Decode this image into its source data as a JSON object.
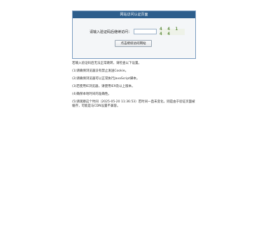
{
  "panel": {
    "title": "网站访问认证页面",
    "prompt_label": "请输入验证码后继续访问：",
    "captcha_text": "4 4 1 4 4",
    "submit_label": "点击继续访问网站"
  },
  "notes": {
    "intro": "若输入验证码后无法正常跳转，请检查以下设置。",
    "items": [
      "(1)请确保浏览器没有禁止发送Cookie。",
      "(2)请确保浏览器可以正常执行JavaScript脚本。",
      "(3)若使用IE浏览器，请使用IE9及以上版本。",
      "(4)确保本地时间的准确性。",
      "(5)请观察这个时间（2025-05-20 11:36:53）若时间一直未变化，则是由于验证页面被缓存，可能是与CDN设置不兼容。"
    ]
  }
}
